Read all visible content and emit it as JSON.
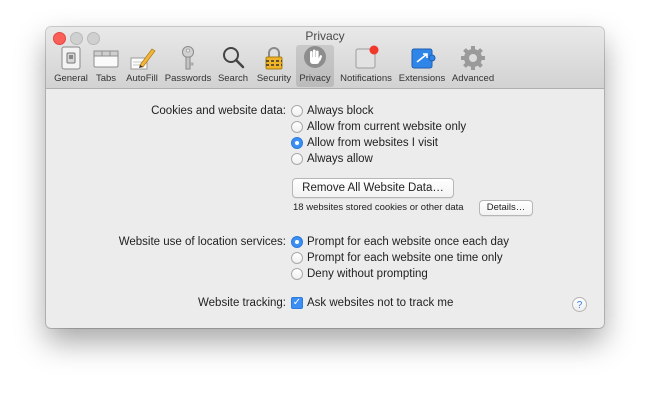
{
  "window": {
    "title": "Privacy"
  },
  "toolbar": {
    "tabs": [
      {
        "label": "General",
        "icon": "general-switch-icon"
      },
      {
        "label": "Tabs",
        "icon": "tabs-icon"
      },
      {
        "label": "AutoFill",
        "icon": "pencil-icon"
      },
      {
        "label": "Passwords",
        "icon": "key-icon"
      },
      {
        "label": "Search",
        "icon": "magnifier-icon"
      },
      {
        "label": "Security",
        "icon": "padlock-icon"
      },
      {
        "label": "Privacy",
        "icon": "hand-icon",
        "selected": true
      },
      {
        "label": "Notifications",
        "icon": "notifications-icon"
      },
      {
        "label": "Extensions",
        "icon": "puzzle-icon"
      },
      {
        "label": "Advanced",
        "icon": "gear-icon"
      }
    ]
  },
  "cookies": {
    "label": "Cookies and website data:",
    "options": [
      {
        "label": "Always block",
        "selected": false
      },
      {
        "label": "Allow from current website only",
        "selected": false
      },
      {
        "label": "Allow from websites I visit",
        "selected": true
      },
      {
        "label": "Always allow",
        "selected": false
      }
    ],
    "remove_button": "Remove All Website Data…",
    "stored_note": "18 websites stored cookies or other data",
    "details_button": "Details…"
  },
  "location": {
    "label": "Website use of location services:",
    "options": [
      {
        "label": "Prompt for each website once each day",
        "selected": true
      },
      {
        "label": "Prompt for each website one time only",
        "selected": false
      },
      {
        "label": "Deny without prompting",
        "selected": false
      }
    ]
  },
  "tracking": {
    "label": "Website tracking:",
    "checkbox_label": "Ask websites not to track me",
    "checked": true
  },
  "help": {
    "glyph": "?"
  },
  "colors": {
    "accent": "#3b8ef4",
    "close": "#fc5f57"
  }
}
